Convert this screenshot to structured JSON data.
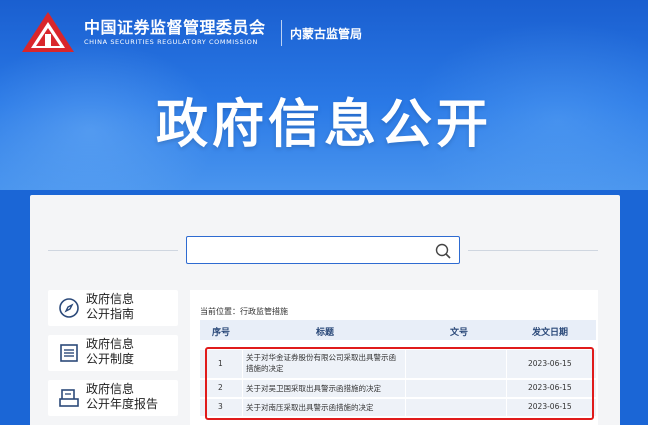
{
  "header": {
    "org_name_cn": "中国证券监督管理委员会",
    "org_name_en": "CHINA SECURITIES REGULATORY COMMISSION",
    "region_name": "内蒙古监管局",
    "logo_icon": "csrc-logo-icon"
  },
  "hero": {
    "title": "政府信息公开"
  },
  "search": {
    "placeholder": "",
    "value": "",
    "icon": "search-icon"
  },
  "sidebar": {
    "items": [
      {
        "line1": "政府信息",
        "line2": "公开指南",
        "icon": "compass-icon"
      },
      {
        "line1": "政府信息",
        "line2": "公开制度",
        "icon": "list-icon"
      },
      {
        "line1": "政府信息",
        "line2": "公开年度报告",
        "icon": "report-icon"
      }
    ]
  },
  "breadcrumb": {
    "label": "当前位置：",
    "current": "行政监管措施"
  },
  "table": {
    "headers": {
      "num": "序号",
      "title": "标题",
      "doc": "文号",
      "date": "发文日期"
    },
    "rows": [
      {
        "num": "1",
        "title_l1": "关于对华金证券股份有限公司采取出具警示函",
        "title_l2": "措施的决定",
        "doc": "",
        "date": "2023-06-15"
      },
      {
        "num": "2",
        "title_l1": "关于对吴卫国采取出具警示函措施的决定",
        "title_l2": "",
        "doc": "",
        "date": "2023-06-15"
      },
      {
        "num": "3",
        "title_l1": "关于对南压采取出具警示函措施的决定",
        "title_l2": "",
        "doc": "",
        "date": "2023-06-15"
      }
    ]
  },
  "colors": {
    "brand_blue": "#1a5fd0",
    "logo_red": "#d9262b",
    "highlight_red": "#e01b1b"
  }
}
